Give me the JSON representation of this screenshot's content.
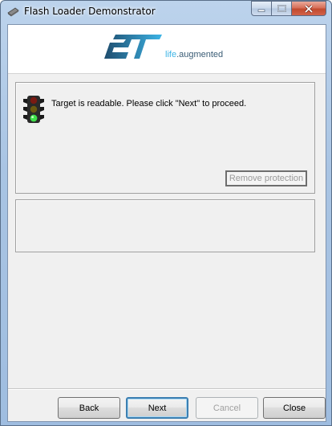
{
  "window": {
    "title": "Flash Loader Demonstrator",
    "icons": {
      "app": "flash-loader-app-icon",
      "minimize": "minimize-icon",
      "maximize": "maximize-icon",
      "close": "close-icon"
    }
  },
  "banner": {
    "logo_text": "ST",
    "tagline_prefix": "life",
    "tagline_suffix": ".augmented",
    "colors": {
      "brand_dark": "#3a5c75",
      "brand_light": "#3cb4e6"
    }
  },
  "status": {
    "icon": "traffic-light-green-icon",
    "message": "Target is readable. Please click \"Next\" to proceed.",
    "remove_protection_label": "Remove protection"
  },
  "info": {
    "text": ""
  },
  "footer": {
    "back_label": "Back",
    "next_label": "Next",
    "cancel_label": "Cancel",
    "close_label": "Close"
  }
}
